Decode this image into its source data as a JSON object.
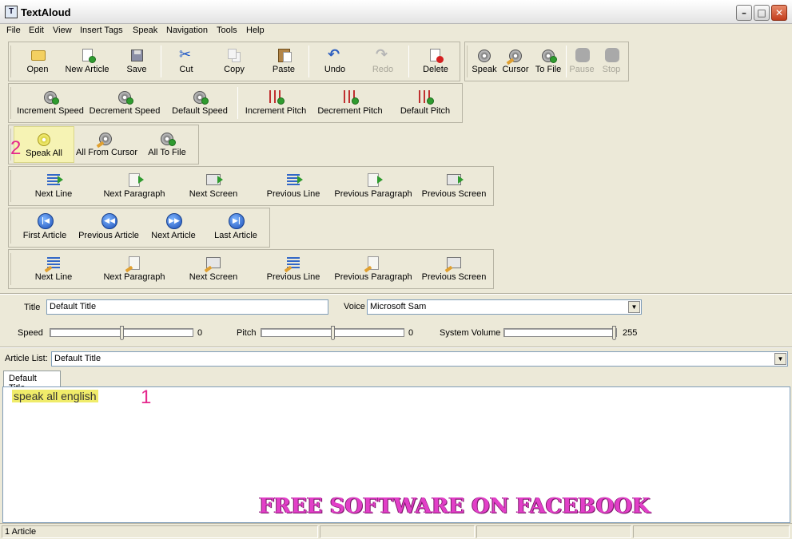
{
  "window": {
    "title": "TextAloud",
    "icon_glyph": "T"
  },
  "menu": [
    "File",
    "Edit",
    "View",
    "Insert Tags",
    "Speak",
    "Navigation",
    "Tools",
    "Help"
  ],
  "toolbar_main": {
    "open": "Open",
    "new_article": "New Article",
    "save": "Save",
    "cut": "Cut",
    "copy": "Copy",
    "paste": "Paste",
    "undo": "Undo",
    "redo": "Redo",
    "delete": "Delete"
  },
  "toolbar_speak": {
    "speak": "Speak",
    "cursor": "Cursor",
    "to_file": "To File",
    "pause": "Pause",
    "stop": "Stop"
  },
  "toolbar_voice": {
    "increment_speed": "Increment Speed",
    "decrement_speed": "Decrement Speed",
    "default_speed": "Default Speed",
    "increment_pitch": "Increment Pitch",
    "decrement_pitch": "Decrement Pitch",
    "default_pitch": "Default Pitch"
  },
  "toolbar_speakall": {
    "speak_all": "Speak All",
    "all_from_cursor": "All From Cursor",
    "all_to_file": "All To File"
  },
  "toolbar_nav": {
    "next_line": "Next Line",
    "next_paragraph": "Next Paragraph",
    "next_screen": "Next Screen",
    "previous_line": "Previous Line",
    "previous_paragraph": "Previous Paragraph",
    "previous_screen": "Previous Screen"
  },
  "toolbar_article": {
    "first_article": "First Article",
    "previous_article": "Previous Article",
    "next_article": "Next Article",
    "last_article": "Last Article"
  },
  "toolbar_nav2": {
    "next_line": "Next Line",
    "next_paragraph": "Next Paragraph",
    "next_screen": "Next Screen",
    "previous_line": "Previous Line",
    "previous_paragraph": "Previous Paragraph",
    "previous_screen": "Previous Screen"
  },
  "form": {
    "title_label": "Title",
    "title_value": "Default Title",
    "voice_label": "Voice",
    "voice_value": "Microsoft Sam",
    "speed_label": "Speed",
    "speed_value": "0",
    "pitch_label": "Pitch",
    "pitch_value": "0",
    "volume_label": "System Volume",
    "volume_value": "255"
  },
  "article_list": {
    "label": "Article List:",
    "value": "Default Title"
  },
  "tab": {
    "label": "Default Title"
  },
  "editor": {
    "text": "speak all english"
  },
  "annotations": {
    "one": "1",
    "two": "2"
  },
  "watermark": "FREE SOFTWARE ON FACEBOOK",
  "status": {
    "articles": "1 Article"
  },
  "colors": {
    "highlight": "#f0ec6a",
    "annotation": "#e5288d",
    "watermark": "#e23fc8"
  }
}
